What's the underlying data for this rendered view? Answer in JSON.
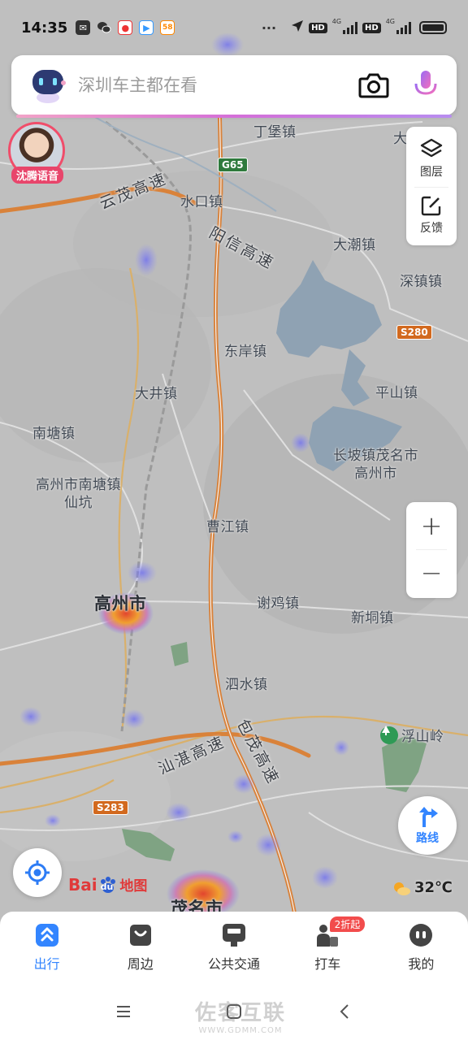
{
  "status_bar": {
    "time": "14:35",
    "dots": "···",
    "network_1": "4G",
    "network_2": "4G",
    "hd": "HD"
  },
  "search": {
    "placeholder": "深圳车主都在看"
  },
  "avatar": {
    "label": "沈腾语音"
  },
  "tools": {
    "layers": "图层",
    "feedback": "反馈"
  },
  "zoom": {
    "in": "+",
    "out": "−"
  },
  "route": {
    "label": "路线"
  },
  "map": {
    "places": {
      "dingbao": "丁堡镇",
      "dapo": "大坡",
      "shuikou": "水口镇",
      "dachao": "大潮镇",
      "shenzhen_town": "深镇镇",
      "dongan": "东岸镇",
      "dajing": "大井镇",
      "pingshan": "平山镇",
      "nantang": "南塘镇",
      "gaozhou_nantang": "高州市南塘镇",
      "xiankeng": "仙坑",
      "changpo_1": "长坡镇茂名市",
      "changpo_2": "高州市",
      "caojiang": "曹江镇",
      "gaozhou": "高州市",
      "xieji": "谢鸡镇",
      "xindong": "新垌镇",
      "sishui": "泗水镇",
      "fushanling": "浮山岭",
      "maoming": "茂名市"
    },
    "roads": {
      "yunmao": "云茂高速",
      "yangxin": "阳信高速",
      "shanzhan": "汕湛高速",
      "baomao": "包茂高速"
    },
    "shields": {
      "g65": "G65",
      "s280": "S280",
      "s283": "S283"
    }
  },
  "logo": {
    "part1": "Bai",
    "part2": "du",
    "part3": "地图"
  },
  "weather": {
    "temperature": "32℃"
  },
  "bottom_nav": {
    "items": [
      {
        "label": "出行"
      },
      {
        "label": "周边"
      },
      {
        "label": "公共交通"
      },
      {
        "label": "打车"
      },
      {
        "label": "我的"
      }
    ],
    "taxi_badge": "2折起"
  },
  "watermark": {
    "line1": "佐客互联",
    "line2": "WWW.GDMM.COM"
  },
  "colors": {
    "accent": "#3385ff",
    "badge": "#f24c4c",
    "highway": "#d9823a",
    "heat": "#e2452f"
  }
}
